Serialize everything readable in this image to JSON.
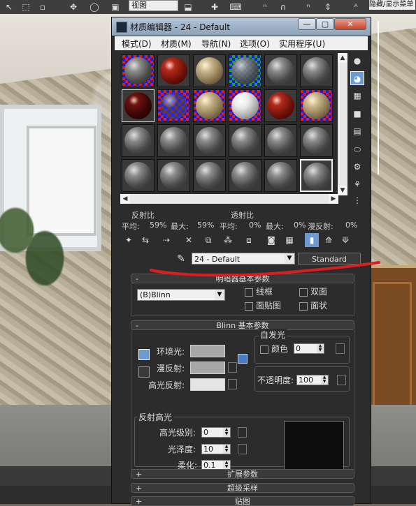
{
  "viewport": {
    "view_select": "视图",
    "right_select": "隐藏/显示菜单"
  },
  "material_editor": {
    "title": "材质编辑器 - 24 - Default",
    "window_buttons": {
      "minimize": "—",
      "maximize": "▢",
      "close": "✕"
    },
    "menu": [
      "模式(D)",
      "材质(M)",
      "导航(N)",
      "选项(O)",
      "实用程序(U)"
    ],
    "stats": {
      "reflect_title": "反射比",
      "transmit_title": "透射比",
      "avg_label": "平均:",
      "max_label": "最大:",
      "reflect_avg": "59%",
      "reflect_max": "59%",
      "transmit_avg": "0%",
      "transmit_max": "0%",
      "diffuse_reflect_label": "漫反射:",
      "diffuse_reflect_val": "0%"
    },
    "material_name": "24 - Default",
    "material_type": "Standard",
    "shader_rollout": {
      "title": "明暗器基本参数",
      "toggle": "-",
      "shader": "(B)Blinn",
      "options": [
        "线框",
        "双面",
        "面贴图",
        "面状"
      ]
    },
    "blinn_rollout": {
      "title": "Blinn 基本参数",
      "toggle": "-",
      "self_illum_title": "自发光",
      "color_label": "颜色",
      "color_value": "0",
      "ambient_label": "环境光:",
      "diffuse_label": "漫反射:",
      "specular_label": "高光反射:",
      "opacity_label": "不透明度:",
      "opacity_value": "100",
      "spec_highlights_title": "反射高光",
      "spec_level_label": "高光级别:",
      "spec_level_value": "0",
      "gloss_label": "光泽度:",
      "gloss_value": "10",
      "soften_label": "柔化:",
      "soften_value": "0.1"
    },
    "collapsed_rollouts": [
      {
        "toggle": "+",
        "title": "扩展参数"
      },
      {
        "toggle": "+",
        "title": "超级采样"
      },
      {
        "toggle": "+",
        "title": "贴图"
      }
    ]
  }
}
